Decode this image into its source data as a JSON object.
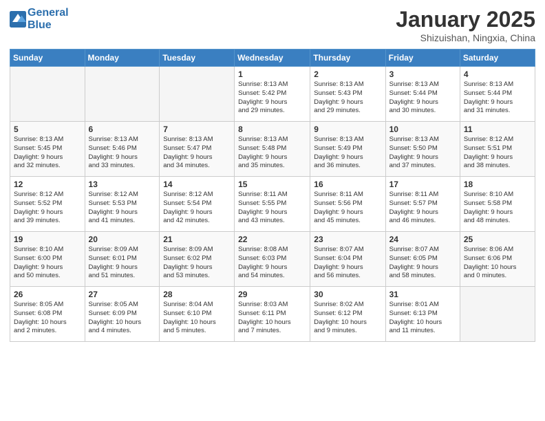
{
  "header": {
    "logo_line1": "General",
    "logo_line2": "Blue",
    "month_title": "January 2025",
    "location": "Shizuishan, Ningxia, China"
  },
  "weekdays": [
    "Sunday",
    "Monday",
    "Tuesday",
    "Wednesday",
    "Thursday",
    "Friday",
    "Saturday"
  ],
  "weeks": [
    [
      {
        "day": "",
        "info": ""
      },
      {
        "day": "",
        "info": ""
      },
      {
        "day": "",
        "info": ""
      },
      {
        "day": "1",
        "info": "Sunrise: 8:13 AM\nSunset: 5:42 PM\nDaylight: 9 hours\nand 29 minutes."
      },
      {
        "day": "2",
        "info": "Sunrise: 8:13 AM\nSunset: 5:43 PM\nDaylight: 9 hours\nand 29 minutes."
      },
      {
        "day": "3",
        "info": "Sunrise: 8:13 AM\nSunset: 5:44 PM\nDaylight: 9 hours\nand 30 minutes."
      },
      {
        "day": "4",
        "info": "Sunrise: 8:13 AM\nSunset: 5:44 PM\nDaylight: 9 hours\nand 31 minutes."
      }
    ],
    [
      {
        "day": "5",
        "info": "Sunrise: 8:13 AM\nSunset: 5:45 PM\nDaylight: 9 hours\nand 32 minutes."
      },
      {
        "day": "6",
        "info": "Sunrise: 8:13 AM\nSunset: 5:46 PM\nDaylight: 9 hours\nand 33 minutes."
      },
      {
        "day": "7",
        "info": "Sunrise: 8:13 AM\nSunset: 5:47 PM\nDaylight: 9 hours\nand 34 minutes."
      },
      {
        "day": "8",
        "info": "Sunrise: 8:13 AM\nSunset: 5:48 PM\nDaylight: 9 hours\nand 35 minutes."
      },
      {
        "day": "9",
        "info": "Sunrise: 8:13 AM\nSunset: 5:49 PM\nDaylight: 9 hours\nand 36 minutes."
      },
      {
        "day": "10",
        "info": "Sunrise: 8:13 AM\nSunset: 5:50 PM\nDaylight: 9 hours\nand 37 minutes."
      },
      {
        "day": "11",
        "info": "Sunrise: 8:12 AM\nSunset: 5:51 PM\nDaylight: 9 hours\nand 38 minutes."
      }
    ],
    [
      {
        "day": "12",
        "info": "Sunrise: 8:12 AM\nSunset: 5:52 PM\nDaylight: 9 hours\nand 39 minutes."
      },
      {
        "day": "13",
        "info": "Sunrise: 8:12 AM\nSunset: 5:53 PM\nDaylight: 9 hours\nand 41 minutes."
      },
      {
        "day": "14",
        "info": "Sunrise: 8:12 AM\nSunset: 5:54 PM\nDaylight: 9 hours\nand 42 minutes."
      },
      {
        "day": "15",
        "info": "Sunrise: 8:11 AM\nSunset: 5:55 PM\nDaylight: 9 hours\nand 43 minutes."
      },
      {
        "day": "16",
        "info": "Sunrise: 8:11 AM\nSunset: 5:56 PM\nDaylight: 9 hours\nand 45 minutes."
      },
      {
        "day": "17",
        "info": "Sunrise: 8:11 AM\nSunset: 5:57 PM\nDaylight: 9 hours\nand 46 minutes."
      },
      {
        "day": "18",
        "info": "Sunrise: 8:10 AM\nSunset: 5:58 PM\nDaylight: 9 hours\nand 48 minutes."
      }
    ],
    [
      {
        "day": "19",
        "info": "Sunrise: 8:10 AM\nSunset: 6:00 PM\nDaylight: 9 hours\nand 50 minutes."
      },
      {
        "day": "20",
        "info": "Sunrise: 8:09 AM\nSunset: 6:01 PM\nDaylight: 9 hours\nand 51 minutes."
      },
      {
        "day": "21",
        "info": "Sunrise: 8:09 AM\nSunset: 6:02 PM\nDaylight: 9 hours\nand 53 minutes."
      },
      {
        "day": "22",
        "info": "Sunrise: 8:08 AM\nSunset: 6:03 PM\nDaylight: 9 hours\nand 54 minutes."
      },
      {
        "day": "23",
        "info": "Sunrise: 8:07 AM\nSunset: 6:04 PM\nDaylight: 9 hours\nand 56 minutes."
      },
      {
        "day": "24",
        "info": "Sunrise: 8:07 AM\nSunset: 6:05 PM\nDaylight: 9 hours\nand 58 minutes."
      },
      {
        "day": "25",
        "info": "Sunrise: 8:06 AM\nSunset: 6:06 PM\nDaylight: 10 hours\nand 0 minutes."
      }
    ],
    [
      {
        "day": "26",
        "info": "Sunrise: 8:05 AM\nSunset: 6:08 PM\nDaylight: 10 hours\nand 2 minutes."
      },
      {
        "day": "27",
        "info": "Sunrise: 8:05 AM\nSunset: 6:09 PM\nDaylight: 10 hours\nand 4 minutes."
      },
      {
        "day": "28",
        "info": "Sunrise: 8:04 AM\nSunset: 6:10 PM\nDaylight: 10 hours\nand 5 minutes."
      },
      {
        "day": "29",
        "info": "Sunrise: 8:03 AM\nSunset: 6:11 PM\nDaylight: 10 hours\nand 7 minutes."
      },
      {
        "day": "30",
        "info": "Sunrise: 8:02 AM\nSunset: 6:12 PM\nDaylight: 10 hours\nand 9 minutes."
      },
      {
        "day": "31",
        "info": "Sunrise: 8:01 AM\nSunset: 6:13 PM\nDaylight: 10 hours\nand 11 minutes."
      },
      {
        "day": "",
        "info": ""
      }
    ]
  ]
}
